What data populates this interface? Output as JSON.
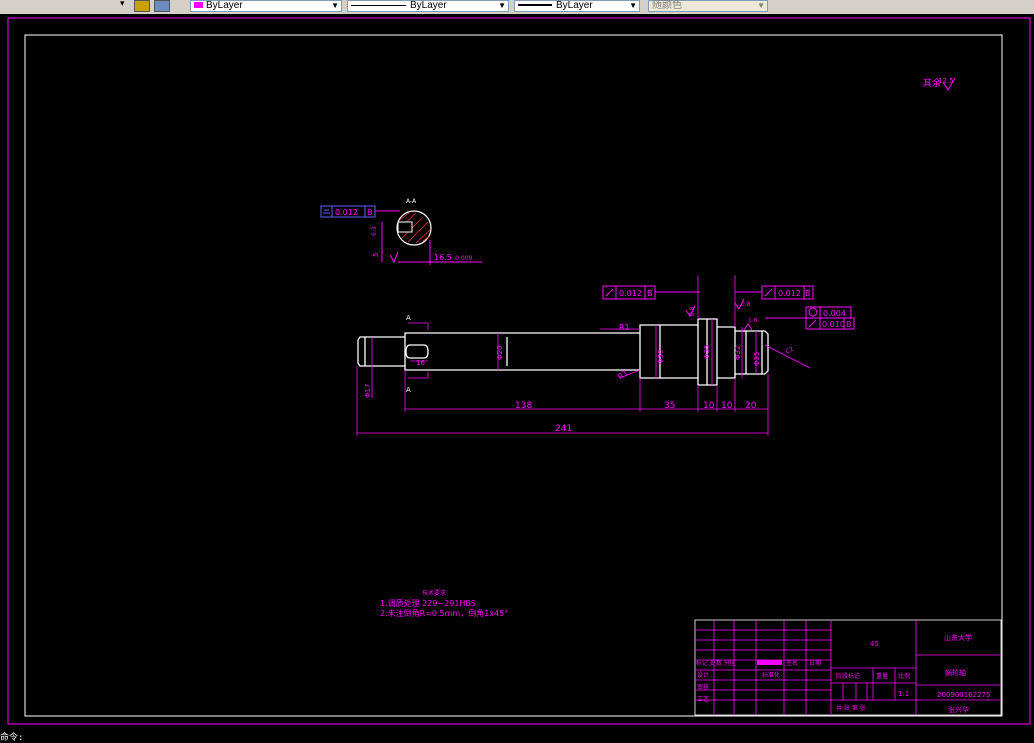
{
  "toolbar": {
    "color_combo": "ByLayer",
    "linetype_combo": "ByLayer",
    "lineweight_combo": "ByLayer",
    "plotstyle_combo": "随颜色",
    "accent_color": "#ff00ff"
  },
  "drawing": {
    "roughness_note": "其余",
    "roughness_value": "12.5",
    "section_label": "A-A",
    "section_tol": "0.012",
    "section_datum": "B",
    "section_keyway_dim": "16.5",
    "section_keyway_tol": "-0.009",
    "section_width_dim": "5",
    "section_ra": "6.3",
    "gt1_value": "0.012",
    "gt1_datum": "B",
    "gt2_value": "0.012",
    "gt2_datum": "B",
    "gt3_value": "0.004",
    "gt4_value": "0.010",
    "gt4_datum": "B",
    "ra_a": "0.8",
    "ra_b": "0.8",
    "ra_c": "1.6",
    "radius1": "R1",
    "radius2": "R1",
    "dia_17": "Φ17",
    "dia_20": "Φ20",
    "dia_30": "Φ30",
    "dia_35": "Φ35",
    "dia_32": "Φ32",
    "dia_25": "Φ25",
    "key_len": "16",
    "cut_a_top": "A",
    "cut_a_bottom": "A",
    "dim_138": "138",
    "dim_35": "35",
    "dim_10a": "10",
    "dim_10b": "10",
    "dim_20": "20",
    "dim_241": "241",
    "chamfer_tag": "C2"
  },
  "notes": {
    "title": "技术要求",
    "line1": "1.调质处理 229~291HBS",
    "line2": "2.未注倒角R=0.5mm，倒角1x45°"
  },
  "titleblock": {
    "school": "山东大学",
    "part_name": "蜗轮轴",
    "material": "45",
    "scale": "1:1",
    "student_id": "200900162275",
    "author": "张兴华",
    "row_marks": "标记 处数 分区",
    "row_file": "更改文件号",
    "row_sign": "签名",
    "row_date": "日期",
    "design": "设计",
    "std": "标准化",
    "check": "审核",
    "process": "工艺",
    "approve": "批准",
    "stage_mark": "阶段标记",
    "weight": "重量",
    "scale_label": "比例",
    "sheets": "共 张 第 张"
  },
  "commandline": "命令:"
}
